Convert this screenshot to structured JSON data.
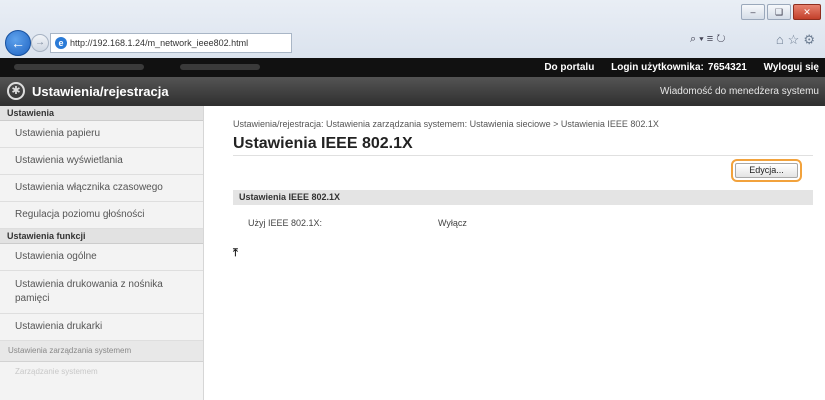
{
  "browser": {
    "url": "http://192.168.1.24/m_network_ieee802.html",
    "address_tools": "⌕▾≡↻",
    "window_controls": [
      "–",
      "❑",
      "✕"
    ],
    "nav_icons": "⌂☆⚙"
  },
  "topbar": {
    "portal_link": "Do portalu",
    "login_label": "Login użytkownika:",
    "login_value": "7654321",
    "logout": "Wyloguj się"
  },
  "header": {
    "title": "Ustawienia/rejestracja",
    "message_link": "Wiadomość do menedżera systemu",
    "gear_symbol": "✱"
  },
  "sidebar": {
    "section1": "Ustawienia",
    "items1": [
      "Ustawienia papieru",
      "Ustawienia wyświetlania",
      "Ustawienia włącznika czasowego",
      "Regulacja poziomu głośności"
    ],
    "section2": "Ustawienia funkcji",
    "items2": [
      "Ustawienia ogólne",
      "Ustawienia drukowania z nośnika pamięci",
      "Ustawienia drukarki"
    ],
    "section3": "Ustawienia zarządzania systemem",
    "faint_item": "Zarządzanie systemem"
  },
  "main": {
    "breadcrumb": "Ustawienia/rejestracja: Ustawienia zarządzania systemem: Ustawienia sieciowe > Ustawienia IEEE 802.1X",
    "title": "Ustawienia IEEE 802.1X",
    "edit_button": "Edycja...",
    "section_header": "Ustawienia IEEE 802.1X",
    "row_label": "Użyj IEEE 802.1X:",
    "row_value": "Wyłącz",
    "top_link": "⤒"
  }
}
